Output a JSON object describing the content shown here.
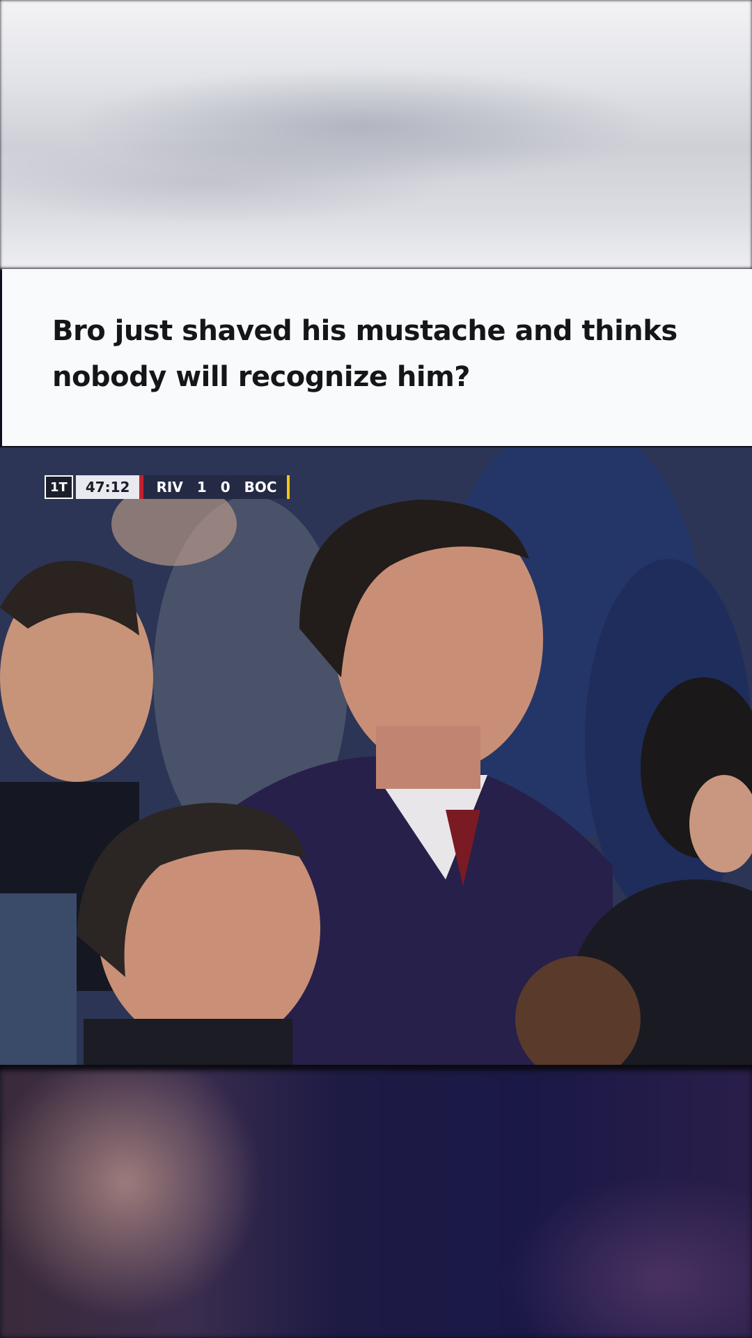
{
  "caption": {
    "text": "Bro just shaved his mustache and thinks nobody will recognize him?"
  },
  "scoreboard": {
    "period": "1T",
    "clock": "47:12",
    "home_team": "RIV",
    "home_score": "1",
    "away_score": "0",
    "away_team": "BOC"
  }
}
